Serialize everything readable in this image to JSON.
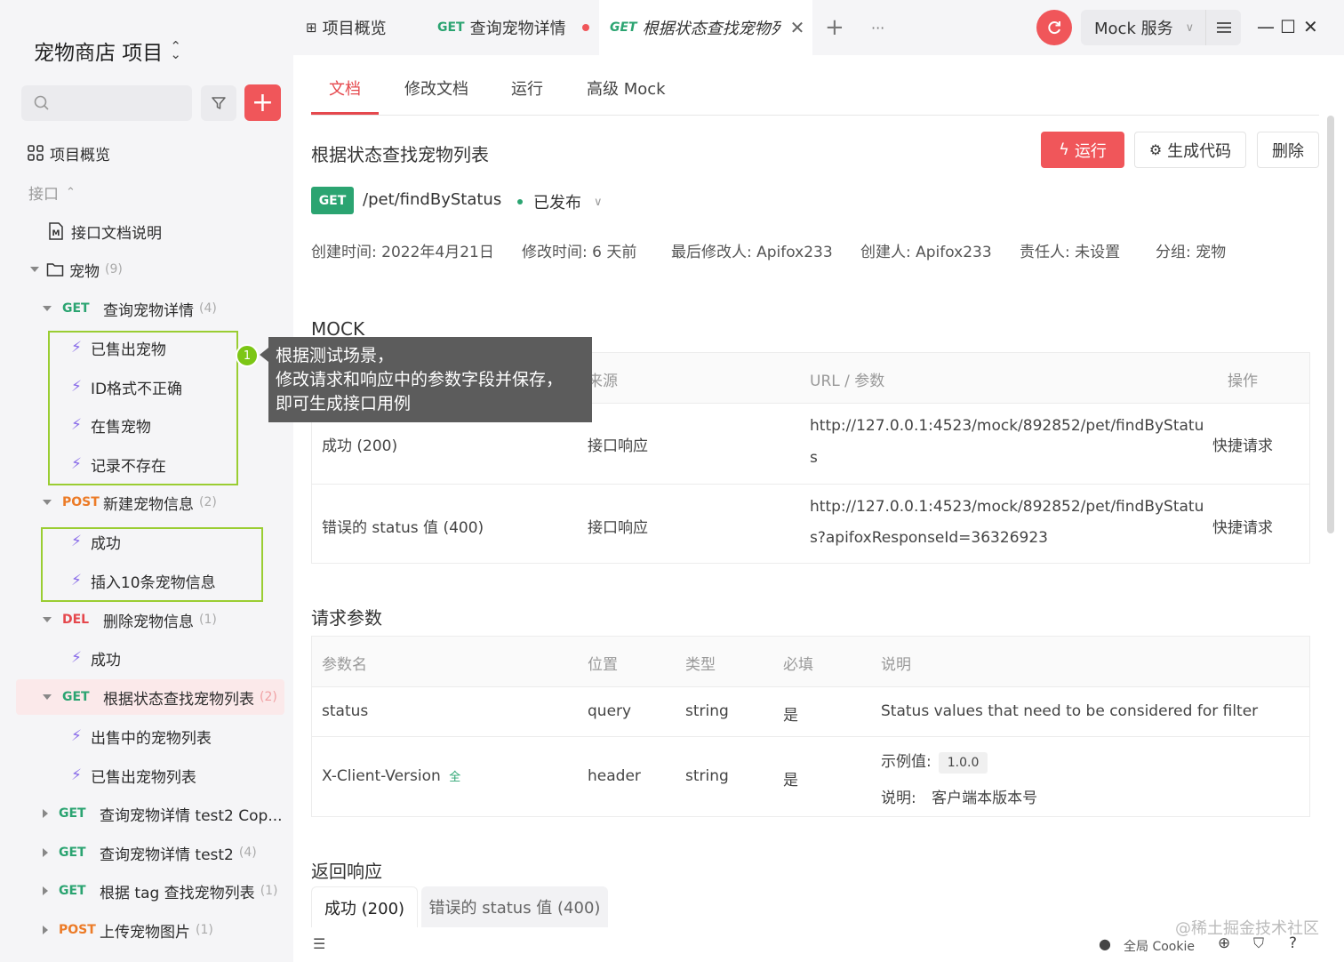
{
  "sidebar": {
    "project_title": "宠物商店 项目",
    "nav_overview": "项目概览",
    "section_api": "接口",
    "doc_item": "接口文档说明",
    "folder": {
      "label": "宠物",
      "count": "(9)"
    },
    "apis": [
      {
        "method": "GET",
        "label": "查询宠物详情",
        "count": "(4)",
        "cases": [
          "已售出宠物",
          "ID格式不正确",
          "在售宠物",
          "记录不存在"
        ]
      },
      {
        "method": "POST",
        "label": "新建宠物信息",
        "count": "(2)",
        "cases": [
          "成功",
          "插入10条宠物信息"
        ]
      },
      {
        "method": "DEL",
        "label": "删除宠物信息",
        "count": "(1)",
        "cases": [
          "成功"
        ]
      },
      {
        "method": "GET",
        "label": "根据状态查找宠物列表",
        "count": "(2)",
        "cases": [
          "出售中的宠物列表",
          "已售出宠物列表"
        ]
      },
      {
        "method": "GET",
        "label": "查询宠物详情 test2 Cop...",
        "count": ""
      },
      {
        "method": "GET",
        "label": "查询宠物详情 test2",
        "count": "(4)"
      },
      {
        "method": "GET",
        "label": "根据 tag 查找宠物列表",
        "count": "(1)"
      },
      {
        "method": "POST",
        "label": "上传宠物图片",
        "count": "(1)"
      }
    ],
    "tooltip": {
      "badge": "1",
      "line1": "根据测试场景，",
      "line2": "修改请求和响应中的参数字段并保存，",
      "line3": "即可生成接口用例"
    }
  },
  "tabs": {
    "overview": "项目概览",
    "tab2_method": "GET",
    "tab2_label": "查询宠物详情",
    "tab3_method": "GET",
    "tab3_label": "根据状态查找宠物列",
    "add": "+",
    "more": "···"
  },
  "mock_service": "Mock 服务",
  "subtabs": [
    "文档",
    "修改文档",
    "运行",
    "高级 Mock"
  ],
  "api": {
    "title": "根据状态查找宠物列表",
    "method": "GET",
    "path": "/pet/findByStatus",
    "status": "已发布",
    "run": "运行",
    "gen_code": "生成代码",
    "delete": "删除",
    "meta": [
      "创建时间: 2022年4月21日",
      "修改时间: 6 天前",
      "最后修改人: Apifox233",
      "创建人: Apifox233",
      "责任人: 未设置",
      "分组: 宠物"
    ]
  },
  "mock": {
    "title": "MOCK",
    "headers": {
      "source": "来源",
      "url": "URL / 参数",
      "op": "操作"
    },
    "rows": [
      {
        "name": "成功 (200)",
        "source": "接口响应",
        "url1": "http://127.0.0.1:4523/mock/892852/pet/findByStatu",
        "url2": "s",
        "op": "快捷请求"
      },
      {
        "name": "错误的 status 值 (400)",
        "source": "接口响应",
        "url1": "http://127.0.0.1:4523/mock/892852/pet/findByStatu",
        "url2": "s?apifoxResponseId=36326923",
        "op": "快捷请求"
      }
    ]
  },
  "params": {
    "title": "请求参数",
    "headers": {
      "name": "参数名",
      "location": "位置",
      "type": "类型",
      "required": "必填",
      "desc": "说明"
    },
    "rows": [
      {
        "name": "status",
        "location": "query",
        "type": "string",
        "required": "是",
        "desc": "Status values that need to be considered for filter"
      },
      {
        "name": "X-Client-Version",
        "badge": "全",
        "location": "header",
        "type": "string",
        "required": "是",
        "example_label": "示例值:",
        "example": "1.0.0",
        "desc_label": "说明:",
        "desc": "客户端本版本号"
      }
    ]
  },
  "response": {
    "title": "返回响应",
    "tabs": [
      "成功 (200)",
      "错误的 status 值 (400)"
    ]
  },
  "bottom": {
    "cookie": "全局 Cookie",
    "watermark": "@稀土掘金技术社区"
  },
  "colors": {
    "accent": "#f0565a",
    "get": "#2ba471",
    "post": "#ec7b27",
    "del": "#e5484d",
    "highlight": "#9acd32"
  }
}
